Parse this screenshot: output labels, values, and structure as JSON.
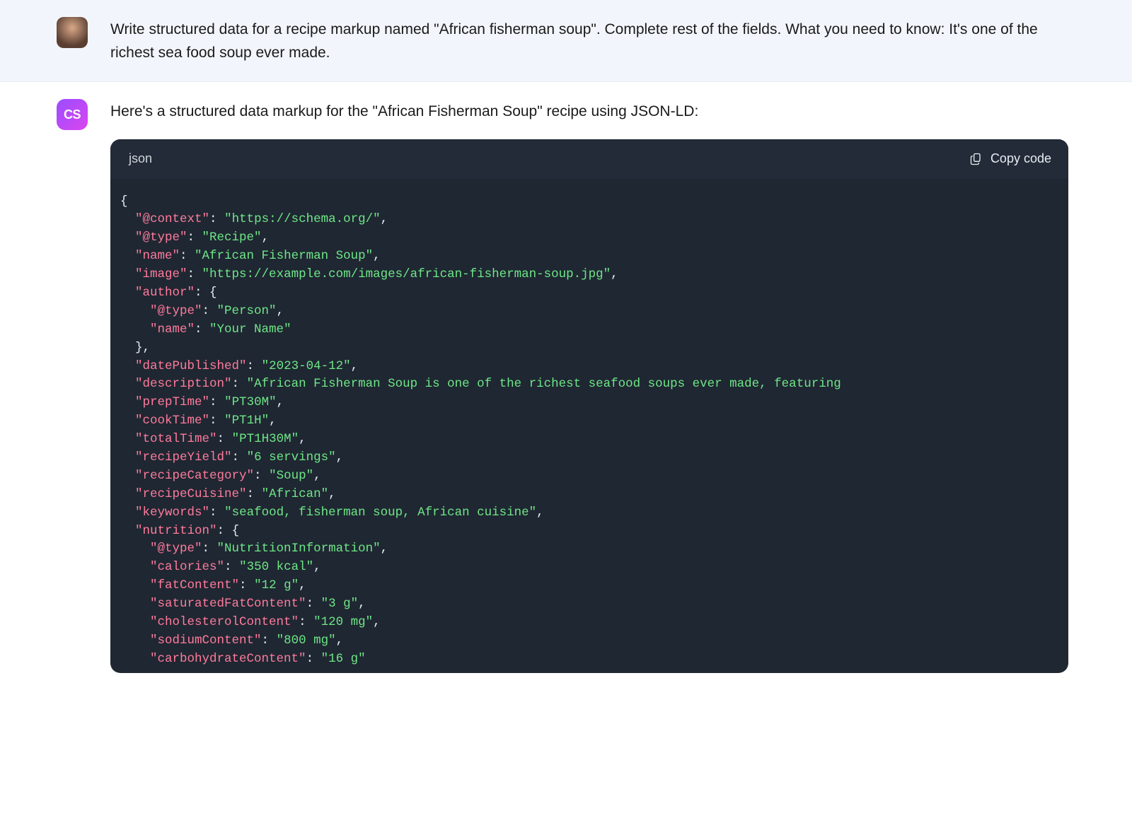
{
  "user": {
    "message": "Write structured data for a recipe markup named \"African fisherman soup\". Complete rest of the fields. What you need to know: It's one of the richest sea food soup ever made."
  },
  "assistant": {
    "avatar_label": "CS",
    "intro": "Here's a structured data markup for the \"African Fisherman Soup\" recipe using JSON-LD:",
    "code_lang": "json",
    "copy_label": "Copy code",
    "code_tokens": [
      {
        "t": "brace",
        "v": "{"
      },
      {
        "t": "nl"
      },
      {
        "t": "indent",
        "n": 1
      },
      {
        "t": "key",
        "v": "\"@context\""
      },
      {
        "t": "punc",
        "v": ": "
      },
      {
        "t": "str",
        "v": "\"https://schema.org/\""
      },
      {
        "t": "punc",
        "v": ","
      },
      {
        "t": "nl"
      },
      {
        "t": "indent",
        "n": 1
      },
      {
        "t": "key",
        "v": "\"@type\""
      },
      {
        "t": "punc",
        "v": ": "
      },
      {
        "t": "str",
        "v": "\"Recipe\""
      },
      {
        "t": "punc",
        "v": ","
      },
      {
        "t": "nl"
      },
      {
        "t": "indent",
        "n": 1
      },
      {
        "t": "key",
        "v": "\"name\""
      },
      {
        "t": "punc",
        "v": ": "
      },
      {
        "t": "str",
        "v": "\"African Fisherman Soup\""
      },
      {
        "t": "punc",
        "v": ","
      },
      {
        "t": "nl"
      },
      {
        "t": "indent",
        "n": 1
      },
      {
        "t": "key",
        "v": "\"image\""
      },
      {
        "t": "punc",
        "v": ": "
      },
      {
        "t": "str",
        "v": "\"https://example.com/images/african-fisherman-soup.jpg\""
      },
      {
        "t": "punc",
        "v": ","
      },
      {
        "t": "nl"
      },
      {
        "t": "indent",
        "n": 1
      },
      {
        "t": "key",
        "v": "\"author\""
      },
      {
        "t": "punc",
        "v": ": "
      },
      {
        "t": "brace",
        "v": "{"
      },
      {
        "t": "nl"
      },
      {
        "t": "indent",
        "n": 2
      },
      {
        "t": "key",
        "v": "\"@type\""
      },
      {
        "t": "punc",
        "v": ": "
      },
      {
        "t": "str",
        "v": "\"Person\""
      },
      {
        "t": "punc",
        "v": ","
      },
      {
        "t": "nl"
      },
      {
        "t": "indent",
        "n": 2
      },
      {
        "t": "key",
        "v": "\"name\""
      },
      {
        "t": "punc",
        "v": ": "
      },
      {
        "t": "str",
        "v": "\"Your Name\""
      },
      {
        "t": "nl"
      },
      {
        "t": "indent",
        "n": 1
      },
      {
        "t": "brace",
        "v": "}"
      },
      {
        "t": "punc",
        "v": ","
      },
      {
        "t": "nl"
      },
      {
        "t": "indent",
        "n": 1
      },
      {
        "t": "key",
        "v": "\"datePublished\""
      },
      {
        "t": "punc",
        "v": ": "
      },
      {
        "t": "str",
        "v": "\"2023-04-12\""
      },
      {
        "t": "punc",
        "v": ","
      },
      {
        "t": "nl"
      },
      {
        "t": "indent",
        "n": 1
      },
      {
        "t": "key",
        "v": "\"description\""
      },
      {
        "t": "punc",
        "v": ": "
      },
      {
        "t": "str",
        "v": "\"African Fisherman Soup is one of the richest seafood soups ever made, featuring"
      },
      {
        "t": "nl"
      },
      {
        "t": "indent",
        "n": 1
      },
      {
        "t": "key",
        "v": "\"prepTime\""
      },
      {
        "t": "punc",
        "v": ": "
      },
      {
        "t": "str",
        "v": "\"PT30M\""
      },
      {
        "t": "punc",
        "v": ","
      },
      {
        "t": "nl"
      },
      {
        "t": "indent",
        "n": 1
      },
      {
        "t": "key",
        "v": "\"cookTime\""
      },
      {
        "t": "punc",
        "v": ": "
      },
      {
        "t": "str",
        "v": "\"PT1H\""
      },
      {
        "t": "punc",
        "v": ","
      },
      {
        "t": "nl"
      },
      {
        "t": "indent",
        "n": 1
      },
      {
        "t": "key",
        "v": "\"totalTime\""
      },
      {
        "t": "punc",
        "v": ": "
      },
      {
        "t": "str",
        "v": "\"PT1H30M\""
      },
      {
        "t": "punc",
        "v": ","
      },
      {
        "t": "nl"
      },
      {
        "t": "indent",
        "n": 1
      },
      {
        "t": "key",
        "v": "\"recipeYield\""
      },
      {
        "t": "punc",
        "v": ": "
      },
      {
        "t": "str",
        "v": "\"6 servings\""
      },
      {
        "t": "punc",
        "v": ","
      },
      {
        "t": "nl"
      },
      {
        "t": "indent",
        "n": 1
      },
      {
        "t": "key",
        "v": "\"recipeCategory\""
      },
      {
        "t": "punc",
        "v": ": "
      },
      {
        "t": "str",
        "v": "\"Soup\""
      },
      {
        "t": "punc",
        "v": ","
      },
      {
        "t": "nl"
      },
      {
        "t": "indent",
        "n": 1
      },
      {
        "t": "key",
        "v": "\"recipeCuisine\""
      },
      {
        "t": "punc",
        "v": ": "
      },
      {
        "t": "str",
        "v": "\"African\""
      },
      {
        "t": "punc",
        "v": ","
      },
      {
        "t": "nl"
      },
      {
        "t": "indent",
        "n": 1
      },
      {
        "t": "key",
        "v": "\"keywords\""
      },
      {
        "t": "punc",
        "v": ": "
      },
      {
        "t": "str",
        "v": "\"seafood, fisherman soup, African cuisine\""
      },
      {
        "t": "punc",
        "v": ","
      },
      {
        "t": "nl"
      },
      {
        "t": "indent",
        "n": 1
      },
      {
        "t": "key",
        "v": "\"nutrition\""
      },
      {
        "t": "punc",
        "v": ": "
      },
      {
        "t": "brace",
        "v": "{"
      },
      {
        "t": "nl"
      },
      {
        "t": "indent",
        "n": 2
      },
      {
        "t": "key",
        "v": "\"@type\""
      },
      {
        "t": "punc",
        "v": ": "
      },
      {
        "t": "str",
        "v": "\"NutritionInformation\""
      },
      {
        "t": "punc",
        "v": ","
      },
      {
        "t": "nl"
      },
      {
        "t": "indent",
        "n": 2
      },
      {
        "t": "key",
        "v": "\"calories\""
      },
      {
        "t": "punc",
        "v": ": "
      },
      {
        "t": "str",
        "v": "\"350 kcal\""
      },
      {
        "t": "punc",
        "v": ","
      },
      {
        "t": "nl"
      },
      {
        "t": "indent",
        "n": 2
      },
      {
        "t": "key",
        "v": "\"fatContent\""
      },
      {
        "t": "punc",
        "v": ": "
      },
      {
        "t": "str",
        "v": "\"12 g\""
      },
      {
        "t": "punc",
        "v": ","
      },
      {
        "t": "nl"
      },
      {
        "t": "indent",
        "n": 2
      },
      {
        "t": "key",
        "v": "\"saturatedFatContent\""
      },
      {
        "t": "punc",
        "v": ": "
      },
      {
        "t": "str",
        "v": "\"3 g\""
      },
      {
        "t": "punc",
        "v": ","
      },
      {
        "t": "nl"
      },
      {
        "t": "indent",
        "n": 2
      },
      {
        "t": "key",
        "v": "\"cholesterolContent\""
      },
      {
        "t": "punc",
        "v": ": "
      },
      {
        "t": "str",
        "v": "\"120 mg\""
      },
      {
        "t": "punc",
        "v": ","
      },
      {
        "t": "nl"
      },
      {
        "t": "indent",
        "n": 2
      },
      {
        "t": "key",
        "v": "\"sodiumContent\""
      },
      {
        "t": "punc",
        "v": ": "
      },
      {
        "t": "str",
        "v": "\"800 mg\""
      },
      {
        "t": "punc",
        "v": ","
      },
      {
        "t": "nl"
      },
      {
        "t": "indent",
        "n": 2
      },
      {
        "t": "key",
        "v": "\"carbohydrateContent\""
      },
      {
        "t": "punc",
        "v": ": "
      },
      {
        "t": "str",
        "v": "\"16 g\""
      }
    ]
  }
}
